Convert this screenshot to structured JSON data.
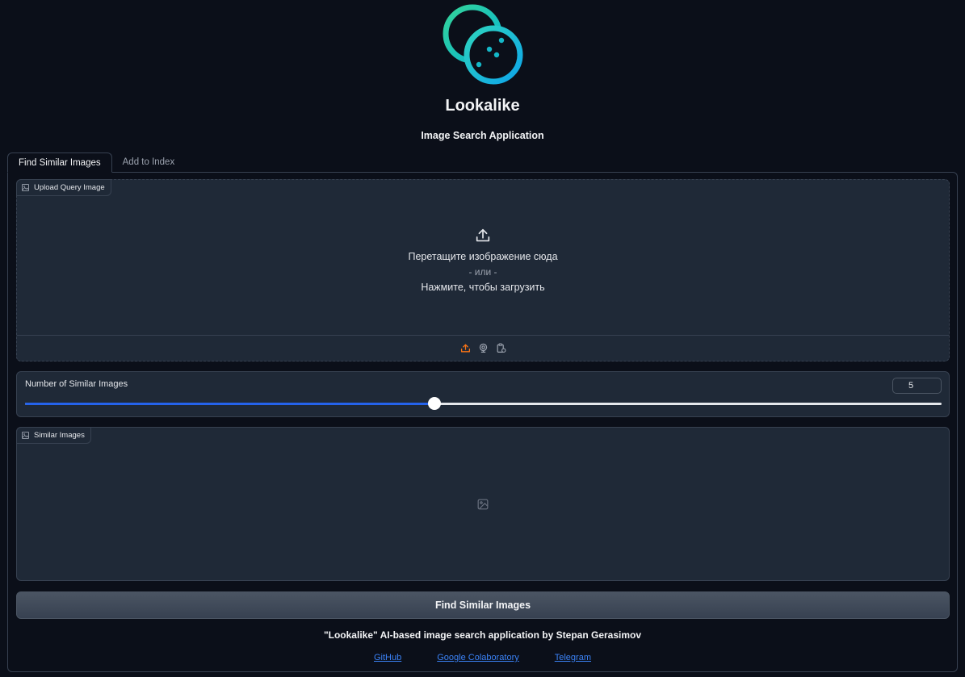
{
  "header": {
    "title": "Lookalike",
    "subtitle": "Image Search Application",
    "logo_icon": "lookalike-logo-icon"
  },
  "tabs": [
    {
      "label": "Find Similar Images",
      "active": true
    },
    {
      "label": "Add to Index",
      "active": false
    }
  ],
  "upload": {
    "label": "Upload Query Image",
    "drop_text": "Перетащите изображение сюда",
    "or_text": "- или -",
    "click_text": "Нажмите, чтобы загрузить",
    "sources": [
      "upload-icon",
      "webcam-icon",
      "clipboard-icon"
    ]
  },
  "slider": {
    "label": "Number of Similar Images",
    "value": "5",
    "fraction": 0.4465
  },
  "gallery": {
    "label": "Similar Images"
  },
  "find_button": {
    "label": "Find Similar Images"
  },
  "footer": {
    "text": "\"Lookalike\" AI-based image search application by Stepan Gerasimov",
    "links": [
      "GitHub",
      "Google Colaboratory",
      "Telegram"
    ]
  },
  "colors": {
    "background": "#0b0f19",
    "panel": "#1f2937",
    "border": "#374151",
    "accent": "#2563eb",
    "link": "#3b82f6",
    "upload_icon_active": "#f97316"
  }
}
